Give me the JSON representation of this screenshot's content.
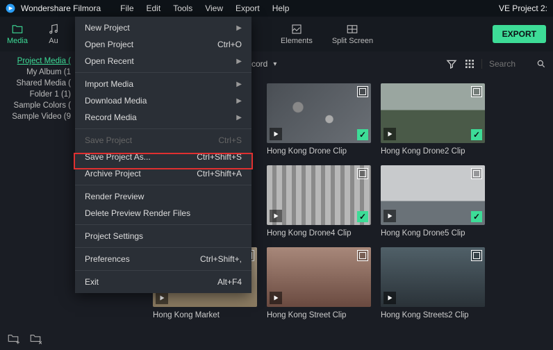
{
  "titlebar": {
    "app_name": "Wondershare Filmora",
    "right_title": "VE Project 2:"
  },
  "menubar": {
    "items": [
      "File",
      "Edit",
      "Tools",
      "View",
      "Export",
      "Help"
    ]
  },
  "toolbar": {
    "tabs": [
      {
        "id": "media",
        "label": "Media"
      },
      {
        "id": "audio",
        "label": "Au"
      },
      {
        "id": "elements",
        "label": "Elements"
      },
      {
        "id": "splitscreen",
        "label": "Split Screen"
      }
    ],
    "export_label": "EXPORT"
  },
  "leftpanel": {
    "items": [
      "Project Media (",
      "My Album (1",
      "Shared Media (",
      "Folder 1 (1)",
      "Sample Colors (",
      "Sample Video (9"
    ]
  },
  "dropdown": {
    "items": [
      {
        "label": "New Project",
        "shortcut": "",
        "arrow": true
      },
      {
        "label": "Open Project",
        "shortcut": "Ctrl+O"
      },
      {
        "label": "Open Recent",
        "shortcut": "",
        "arrow": true
      },
      {
        "sep": true
      },
      {
        "label": "Import Media",
        "shortcut": "",
        "arrow": true
      },
      {
        "label": "Download Media",
        "shortcut": "",
        "arrow": true
      },
      {
        "label": "Record Media",
        "shortcut": "",
        "arrow": true
      },
      {
        "sep": true
      },
      {
        "label": "Save Project",
        "shortcut": "Ctrl+S",
        "disabled": true
      },
      {
        "label": "Save Project As...",
        "shortcut": "Ctrl+Shift+S"
      },
      {
        "label": "Archive Project",
        "shortcut": "Ctrl+Shift+A",
        "highlight": true
      },
      {
        "sep": true
      },
      {
        "label": "Render Preview",
        "shortcut": ""
      },
      {
        "label": "Delete Preview Render Files",
        "shortcut": ""
      },
      {
        "sep": true
      },
      {
        "label": "Project Settings",
        "shortcut": ""
      },
      {
        "sep": true
      },
      {
        "label": "Preferences",
        "shortcut": "Ctrl+Shift+,"
      },
      {
        "sep": true
      },
      {
        "label": "Exit",
        "shortcut": "Alt+F4"
      }
    ]
  },
  "subtoolbar": {
    "cord_label": "cord",
    "search_placeholder": "Search"
  },
  "clips": [
    {
      "name": "Hong Kong Drone Clip",
      "checked": true,
      "thumb": "hk1"
    },
    {
      "name": "Hong Kong Drone2 Clip",
      "checked": true,
      "thumb": "hk2"
    },
    {
      "name": "Hong Kong Drone4 Clip",
      "checked": true,
      "thumb": "hk4"
    },
    {
      "name": "Hong Kong Drone5 Clip",
      "checked": true,
      "thumb": "hk5"
    },
    {
      "name": "Hong Kong Market",
      "checked": false,
      "thumb": "mkt"
    },
    {
      "name": "Hong Kong Street Clip",
      "checked": false,
      "thumb": "str"
    },
    {
      "name": "Hong Kong Streets2 Clip",
      "checked": false,
      "thumb": "str2"
    }
  ]
}
